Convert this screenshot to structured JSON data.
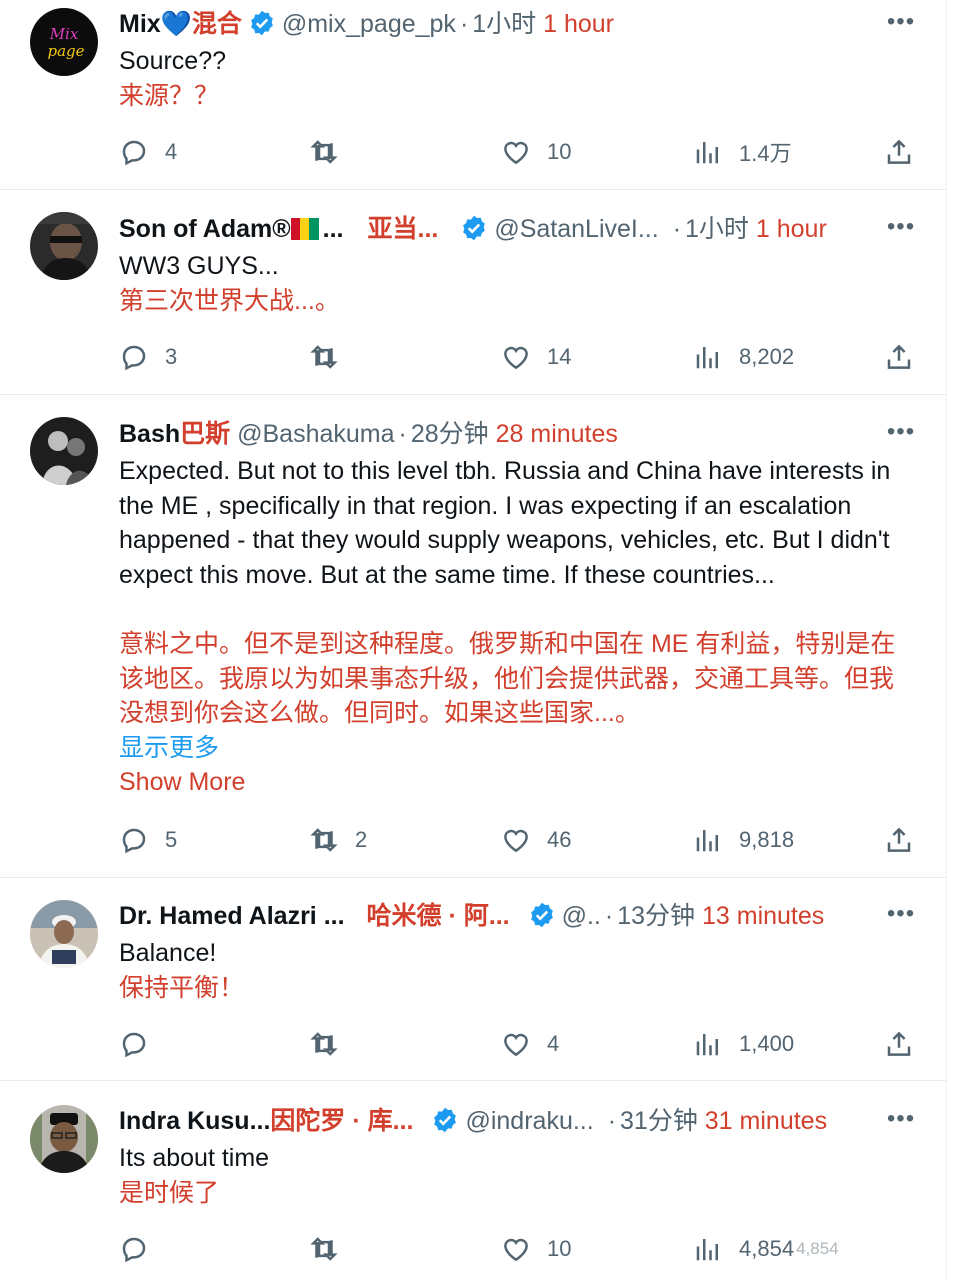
{
  "tweets": [
    {
      "name": "Mix",
      "name_heart": "💙",
      "name_cn": "混合",
      "handle": "@mix_page_pk",
      "dot": "·",
      "time_cn": "1小时",
      "time_en": "1 hour",
      "verified": true,
      "text_en": "Source??",
      "text_cn": "来源？？",
      "replies": "4",
      "retweets": "",
      "likes": "10",
      "views": "1.4万",
      "avatar_text": "Mix page"
    },
    {
      "name": "Son of Adam®",
      "name_ellipsis": "...",
      "name_cn": "亚当...",
      "handle": "@SatanLiveI...",
      "dot": "·",
      "time_cn": "1小时",
      "time_en": "1 hour",
      "verified": true,
      "text_en": "WW3 GUYS...",
      "text_cn": "第三次世界大战...。",
      "replies": "3",
      "retweets": "",
      "likes": "14",
      "views": "8,202"
    },
    {
      "name": "Bash",
      "name_cn": "巴斯",
      "handle": "@Bashakuma",
      "dot": "·",
      "time_cn": "28分钟",
      "time_en": "28 minutes",
      "verified": false,
      "text_en": "Expected. But not to this level tbh. Russia and China have interests in the ME , specifically in that region. I was expecting if an escalation happened  - that they would supply weapons, vehicles, etc. But I didn't expect this move. But at the same time. If these countries...",
      "text_cn": "意料之中。但不是到这种程度。俄罗斯和中国在 ME 有利益，特别是在该地区。我原以为如果事态升级，他们会提供武器，交通工具等。但我没想到你会这么做。但同时。如果这些国家...。",
      "show_more_cn": "显示更多",
      "show_more_en": "Show More",
      "replies": "5",
      "retweets": "2",
      "likes": "46",
      "views": "9,818"
    },
    {
      "name": "Dr. Hamed Alazri ...",
      "name_cn": "哈米德 · 阿...",
      "handle": "@..",
      "dot": "·",
      "time_cn": "13分钟",
      "time_en": "13 minutes",
      "verified": true,
      "text_en": "Balance!",
      "text_cn": "保持平衡！",
      "replies": "",
      "retweets": "",
      "likes": "4",
      "views": "1,400"
    },
    {
      "name": "Indra Kusu...",
      "name_cn": "因陀罗 · 库...",
      "handle": "@indraku...",
      "dot": "·",
      "time_cn": "31分钟",
      "time_en": "31 minutes",
      "verified": true,
      "text_en": "Its about time",
      "text_cn": "是时候了",
      "replies": "",
      "retweets": "",
      "likes": "10",
      "views": "4,854",
      "views_overlay": "4,854"
    }
  ],
  "icons": {
    "reply": "reply-icon",
    "retweet": "retweet-icon",
    "like": "heart-icon",
    "views": "views-icon",
    "share": "share-icon",
    "more": "more-icon",
    "verified": "verified-badge-icon"
  },
  "colors": {
    "accent": "#1d9bf0",
    "translation": "#d2402d",
    "secondary": "#536471"
  },
  "guinea_flag": [
    "#ce1126",
    "#fcd116",
    "#009460"
  ]
}
